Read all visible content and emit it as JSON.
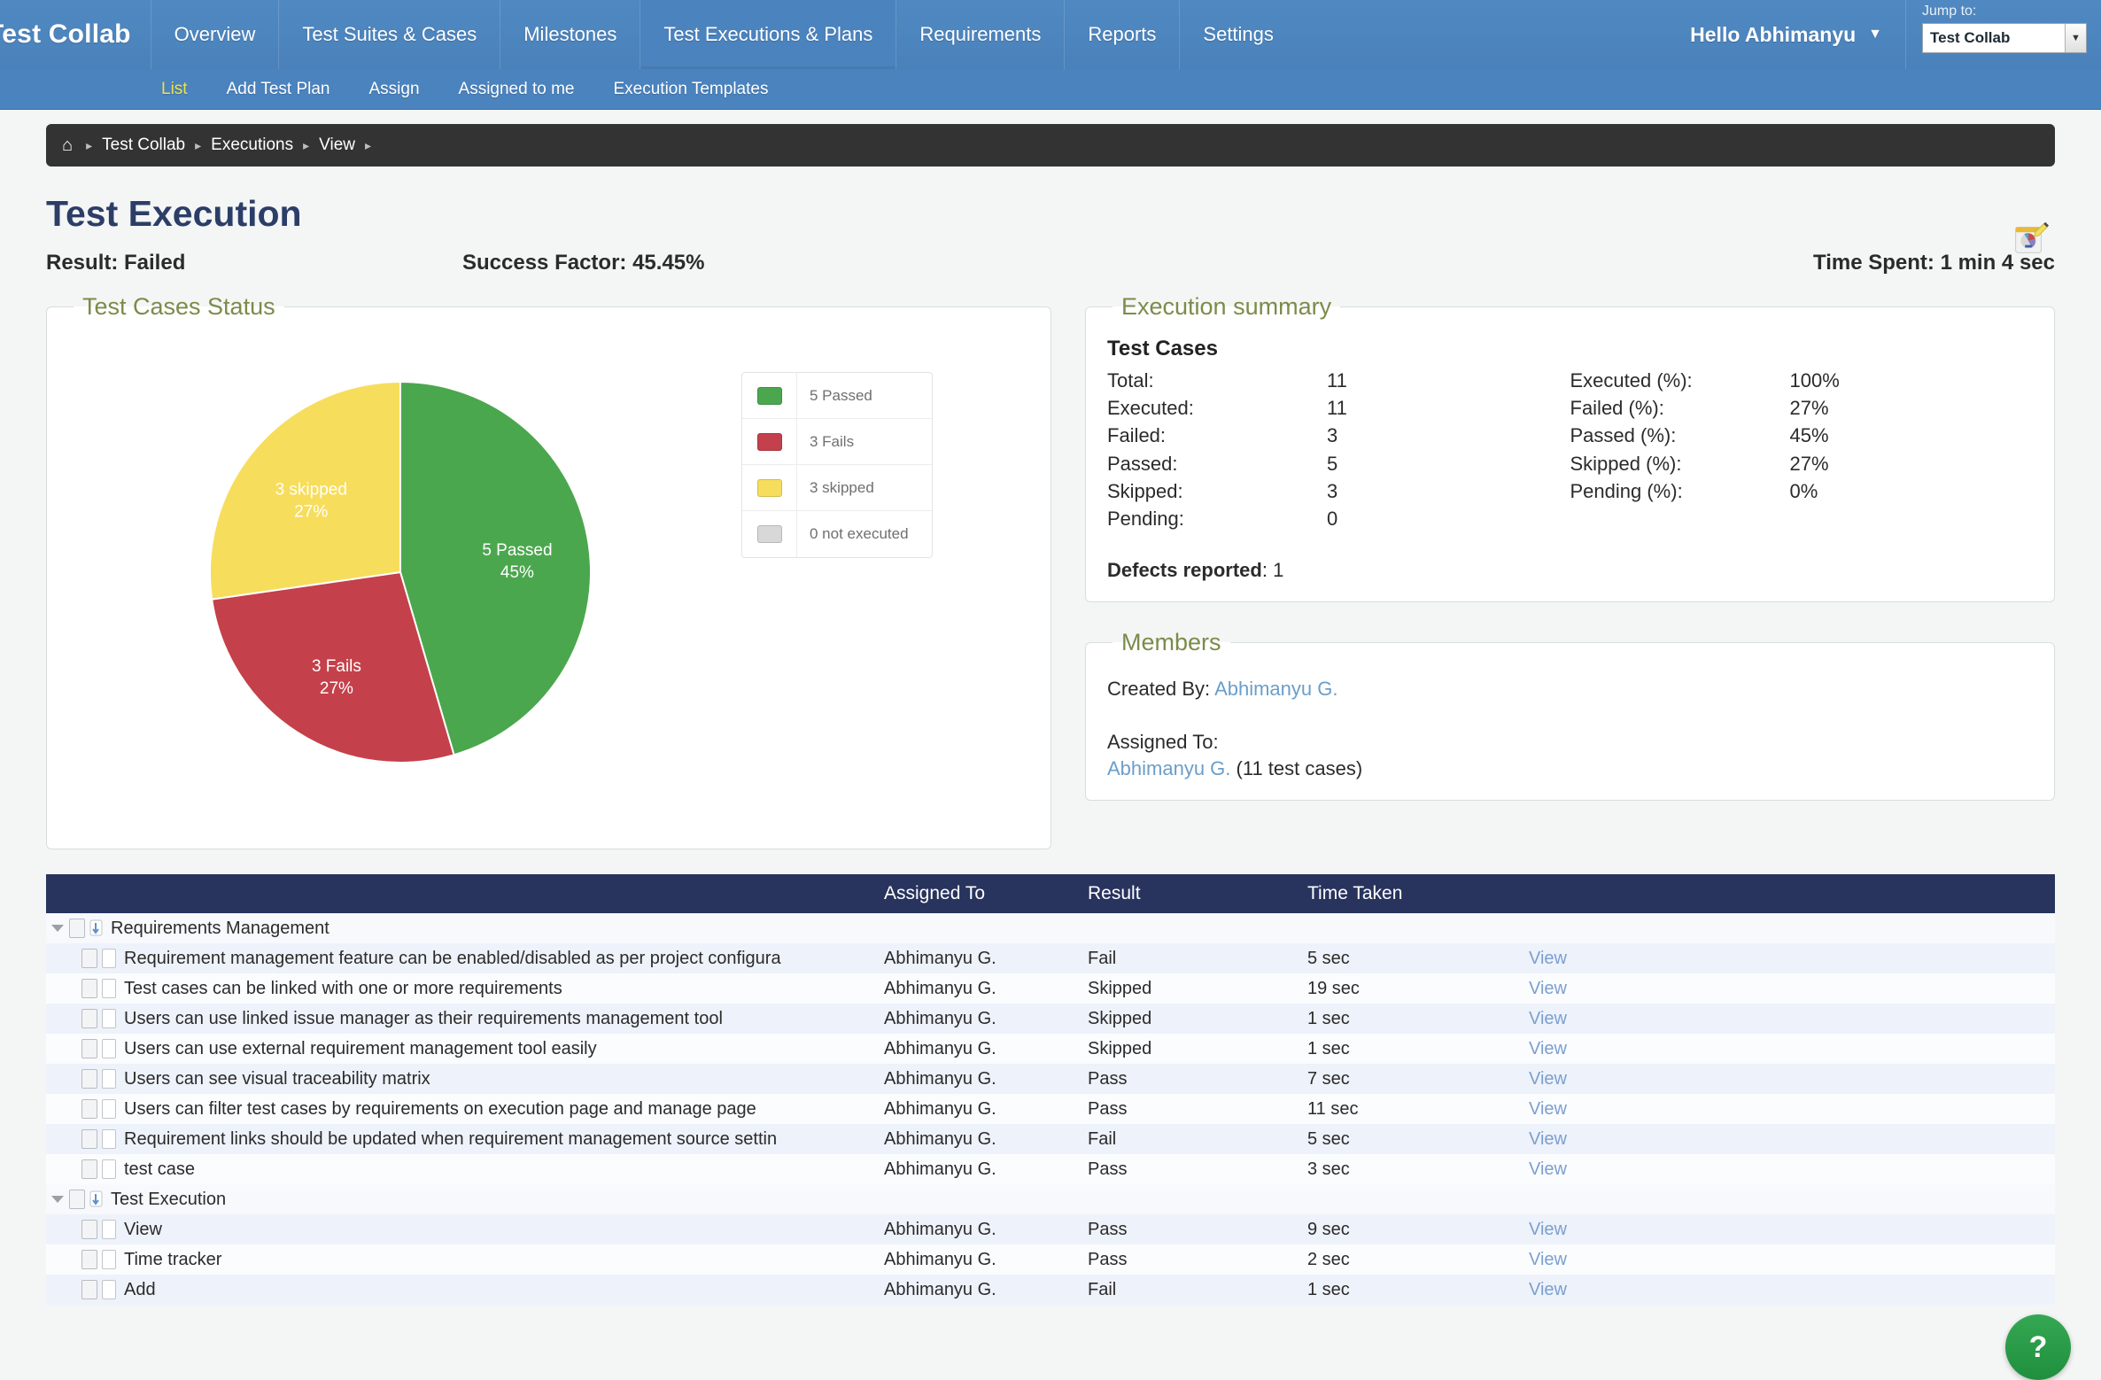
{
  "nav": {
    "brand": "Test Collab",
    "tabs": [
      {
        "label": "Overview",
        "active": false
      },
      {
        "label": "Test Suites & Cases",
        "active": false
      },
      {
        "label": "Milestones",
        "active": false
      },
      {
        "label": "Test Executions & Plans",
        "active": true
      },
      {
        "label": "Requirements",
        "active": false
      },
      {
        "label": "Reports",
        "active": false
      },
      {
        "label": "Settings",
        "active": false
      }
    ],
    "user_greeting": "Hello Abhimanyu",
    "user_caret": "▼",
    "jump_to_label": "Jump to:",
    "jump_to_value": "Test Collab",
    "jump_to_arrow": "▼"
  },
  "subnav": {
    "items": [
      {
        "label": "List",
        "selected": true
      },
      {
        "label": "Add Test Plan",
        "selected": false
      },
      {
        "label": "Assign",
        "selected": false
      },
      {
        "label": "Assigned to me",
        "selected": false
      },
      {
        "label": "Execution Templates",
        "selected": false
      }
    ]
  },
  "breadcrumb": {
    "home_icon": "⌂",
    "items": [
      "Test Collab",
      "Executions",
      "View"
    ],
    "separator": "▸"
  },
  "header": {
    "title": "Test Execution",
    "result": "Result: Failed",
    "success_factor": "Success Factor: 45.45%",
    "time_spent": "Time Spent: 1 min 4 sec"
  },
  "chart_panel": {
    "legend_title": "Test Cases Status"
  },
  "chart_data": {
    "type": "pie",
    "title": "Test Cases Status",
    "legend_position": "right",
    "categories": [
      "5 Passed",
      "3 Fails",
      "3 skipped",
      "0 not executed"
    ],
    "values": [
      5,
      3,
      3,
      0
    ],
    "percents": [
      "45%",
      "27%",
      "27%",
      "0%"
    ],
    "colors": [
      "#4aa css",
      "#c8414b",
      "#f7dc51",
      "#d6d6d6"
    ],
    "slice_colors": [
      "#4ba74e",
      "#c4404a",
      "#f7dd5c",
      "#d8d8d8"
    ],
    "slices": [
      {
        "label": "5 Passed",
        "value": 5,
        "percent": "45%",
        "color": "#4ba74e",
        "inner_label": "5 Passed",
        "inner_percent": "45%"
      },
      {
        "label": "3 Fails",
        "value": 3,
        "percent": "27%",
        "color": "#c4404a",
        "inner_label": "3 Fails",
        "inner_percent": "27%"
      },
      {
        "label": "3 skipped",
        "value": 3,
        "percent": "27%",
        "color": "#f7dd5c",
        "inner_label": "3 skipped",
        "inner_percent": "27%"
      },
      {
        "label": "0 not executed",
        "value": 0,
        "percent": "0%",
        "color": "#d8d8d8",
        "inner_label": "",
        "inner_percent": ""
      }
    ],
    "legend": [
      {
        "label": "5 Passed",
        "color": "#4ba74e"
      },
      {
        "label": "3 Fails",
        "color": "#c4404a"
      },
      {
        "label": "3 skipped",
        "color": "#f7dd5c"
      },
      {
        "label": "0 not executed",
        "color": "#d8d8d8"
      }
    ]
  },
  "summary": {
    "legend": "Execution summary",
    "section_title": "Test Cases",
    "left": [
      {
        "key": "Total:",
        "value": "11"
      },
      {
        "key": "Executed:",
        "value": "11"
      },
      {
        "key": "Failed:",
        "value": "3"
      },
      {
        "key": "Passed:",
        "value": "5"
      },
      {
        "key": "Skipped:",
        "value": "3"
      },
      {
        "key": "Pending:",
        "value": "0"
      }
    ],
    "right": [
      {
        "key": "",
        "value": ""
      },
      {
        "key": "Executed (%):",
        "value": "100%"
      },
      {
        "key": "Failed (%):",
        "value": "27%"
      },
      {
        "key": "Passed (%):",
        "value": "45%"
      },
      {
        "key": "Skipped (%):",
        "value": "27%"
      },
      {
        "key": "Pending (%):",
        "value": "0%"
      }
    ],
    "defects_label": "Defects reported",
    "defects_value": ": 1"
  },
  "members": {
    "legend": "Members",
    "created_by_label": "Created By: ",
    "created_by_value": "Abhimanyu G.",
    "assigned_to_label": "Assigned To:",
    "assigned_to_name": "Abhimanyu G.",
    "assigned_to_count": " (11 test cases)"
  },
  "table": {
    "columns": [
      "",
      "Assigned To",
      "Result",
      "Time Taken",
      ""
    ],
    "view_label": "View",
    "rows": [
      {
        "type": "group",
        "name": "Requirements Management",
        "assigned": "",
        "result": "",
        "time": "",
        "view": ""
      },
      {
        "type": "case",
        "name": "Requirement management feature can be enabled/disabled as per project configura",
        "assigned": "Abhimanyu G.",
        "result": "Fail",
        "time": "5 sec",
        "view": "View"
      },
      {
        "type": "case",
        "name": "Test cases can be linked with one or more requirements",
        "assigned": "Abhimanyu G.",
        "result": "Skipped",
        "time": "19 sec",
        "view": "View"
      },
      {
        "type": "case",
        "name": "Users can use linked issue manager as their requirements management tool",
        "assigned": "Abhimanyu G.",
        "result": "Skipped",
        "time": "1 sec",
        "view": "View"
      },
      {
        "type": "case",
        "name": "Users can use external requirement management tool easily",
        "assigned": "Abhimanyu G.",
        "result": "Skipped",
        "time": "1 sec",
        "view": "View"
      },
      {
        "type": "case",
        "name": "Users can see visual traceability matrix",
        "assigned": "Abhimanyu G.",
        "result": "Pass",
        "time": "7 sec",
        "view": "View"
      },
      {
        "type": "case",
        "name": "Users can filter test cases by requirements on execution page and manage page",
        "assigned": "Abhimanyu G.",
        "result": "Pass",
        "time": "11 sec",
        "view": "View"
      },
      {
        "type": "case",
        "name": "Requirement links should be updated when requirement management source settin",
        "assigned": "Abhimanyu G.",
        "result": "Fail",
        "time": "5 sec",
        "view": "View"
      },
      {
        "type": "case",
        "name": "test case",
        "assigned": "Abhimanyu G.",
        "result": "Pass",
        "time": "3 sec",
        "view": "View"
      },
      {
        "type": "group",
        "name": "Test Execution",
        "assigned": "",
        "result": "",
        "time": "",
        "view": ""
      },
      {
        "type": "case",
        "name": "View",
        "assigned": "Abhimanyu G.",
        "result": "Pass",
        "time": "9 sec",
        "view": "View"
      },
      {
        "type": "case",
        "name": "Time tracker",
        "assigned": "Abhimanyu G.",
        "result": "Pass",
        "time": "2 sec",
        "view": "View"
      },
      {
        "type": "case",
        "name": "Add",
        "assigned": "Abhimanyu G.",
        "result": "Fail",
        "time": "1 sec",
        "view": "View"
      }
    ]
  },
  "help_button": {
    "glyph": "?"
  }
}
